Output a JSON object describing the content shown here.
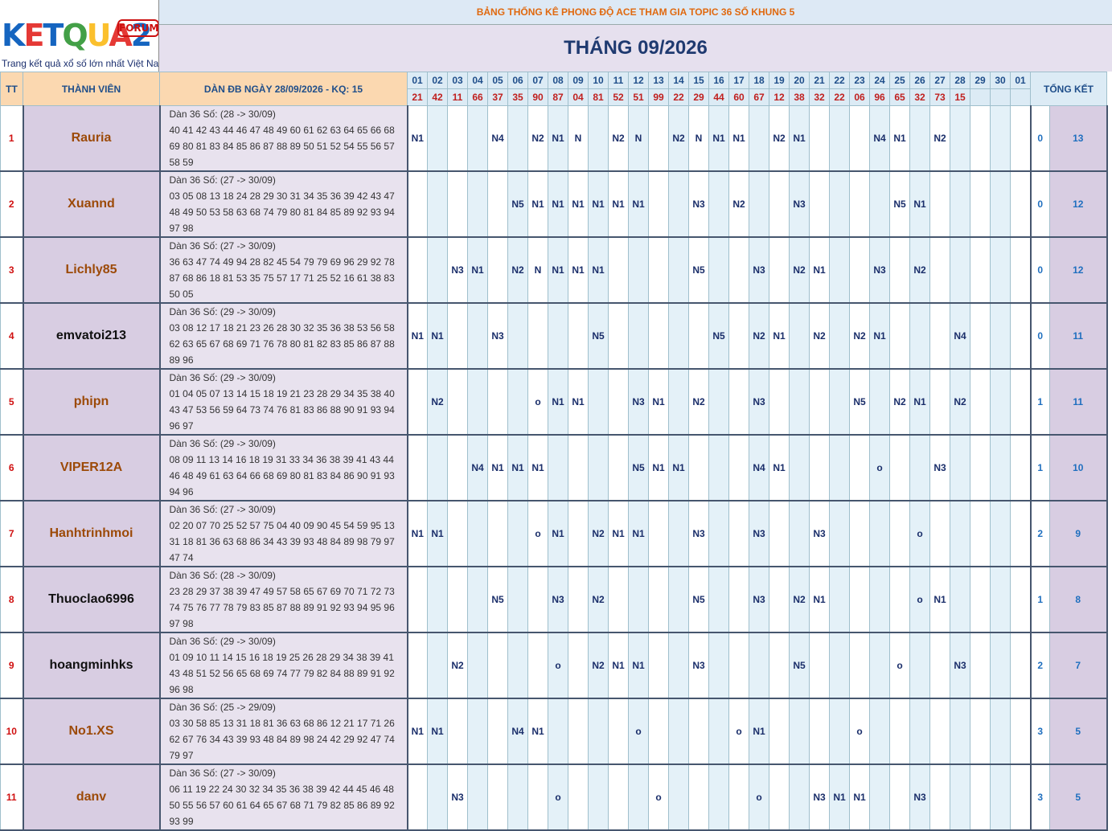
{
  "logo": {
    "letters": [
      {
        "ch": "K",
        "color": "#1565c0"
      },
      {
        "ch": "E",
        "color": "#e53935"
      },
      {
        "ch": "T",
        "color": "#1565c0"
      },
      {
        "ch": "Q",
        "color": "#43a047"
      },
      {
        "ch": "U",
        "color": "#fbc02d"
      },
      {
        "ch": "A",
        "color": "#e53935"
      },
      {
        "ch": "2",
        "color": "#1565c0"
      }
    ],
    "forum": "FORUM",
    "tagline": "Trang kết quả xổ số lớn nhất Việt Nam"
  },
  "banner": "BẢNG THỐNG KÊ PHONG ĐỘ ACE THAM GIA TOPIC 36 SỐ KHUNG 5",
  "month": "THÁNG 09/2026",
  "headers": {
    "tt": "TT",
    "member": "THÀNH VIÊN",
    "dan": "DÀN ĐB NGÀY 28/09/2026 - KQ: 15",
    "total": "TỔNG KẾT"
  },
  "days": [
    "01",
    "02",
    "03",
    "04",
    "05",
    "06",
    "07",
    "08",
    "09",
    "10",
    "11",
    "12",
    "13",
    "14",
    "15",
    "16",
    "17",
    "18",
    "19",
    "20",
    "21",
    "22",
    "23",
    "24",
    "25",
    "26",
    "27",
    "28",
    "29",
    "30",
    "01"
  ],
  "results": [
    "21",
    "42",
    "11",
    "66",
    "37",
    "35",
    "90",
    "87",
    "04",
    "81",
    "52",
    "51",
    "99",
    "22",
    "29",
    "44",
    "60",
    "67",
    "12",
    "38",
    "32",
    "22",
    "06",
    "96",
    "65",
    "32",
    "73",
    "15",
    "",
    "",
    ""
  ],
  "rows": [
    {
      "tt": "1",
      "name": "Rauria",
      "color": "brown",
      "title": "Dàn 36 Số: (28 -> 30/09)",
      "nums": "40 41 42 43 44 46 47 48 49 60 61 62 63 64 65 66 68 69 80 81 83 84 85 86 87 88 89 50 51 52 54 55 56 57 58 59",
      "cells": {
        "1": "N1",
        "5": "N4",
        "7": "N2",
        "8": "N1",
        "9": "N",
        "11": "N2",
        "12": "N",
        "14": "N2",
        "15": "N",
        "16": "N1",
        "17": "N1",
        "19": "N2",
        "20": "N1",
        "24": "N4",
        "25": "N1",
        "27": "N2"
      },
      "t1": "0",
      "t2": "13"
    },
    {
      "tt": "2",
      "name": "Xuannd",
      "color": "brown",
      "title": "Dàn 36 Số: (27 -> 30/09)",
      "nums": "03 05 08 13 18 24 28 29 30 31 34 35 36 39 42 43 47 48 49 50 53 58 63 68 74 79 80 81 84 85 89 92 93 94 97 98",
      "cells": {
        "6": "N5",
        "7": "N1",
        "8": "N1",
        "9": "N1",
        "10": "N1",
        "11": "N1",
        "12": "N1",
        "15": "N3",
        "17": "N2",
        "20": "N3",
        "25": "N5",
        "26": "N1"
      },
      "t1": "0",
      "t2": "12"
    },
    {
      "tt": "3",
      "name": "Lichly85",
      "color": "brown",
      "title": "Dàn 36 Số: (27 -> 30/09)",
      "nums": "36 63 47 74 49 94 28 82 45 54 79 79 69 96 29 92 78 87 68 86 18 81 53 35 75 57 17 71 25 52 16 61 38 83 50 05",
      "cells": {
        "3": "N3",
        "4": "N1",
        "6": "N2",
        "7": "N",
        "8": "N1",
        "9": "N1",
        "10": "N1",
        "15": "N5",
        "18": "N3",
        "20": "N2",
        "21": "N1",
        "24": "N3",
        "26": "N2"
      },
      "t1": "0",
      "t2": "12"
    },
    {
      "tt": "4",
      "name": "emvatoi213",
      "color": "black",
      "title": "Dàn 36 Số: (29 -> 30/09)",
      "nums": "03 08 12 17 18 21 23 26 28 30 32 35 36 38 53 56 58 62 63 65 67 68 69 71 76 78 80 81 82 83 85 86 87 88 89 96",
      "cells": {
        "1": "N1",
        "2": "N1",
        "5": "N3",
        "10": "N5",
        "16": "N5",
        "18": "N2",
        "19": "N1",
        "21": "N2",
        "23": "N2",
        "24": "N1",
        "28": "N4"
      },
      "t1": "0",
      "t2": "11"
    },
    {
      "tt": "5",
      "name": "phipn",
      "color": "brown",
      "title": "Dàn 36 Số: (29 -> 30/09)",
      "nums": "01 04 05 07 13 14 15 18 19 21 23 28 29 34 35 38 40 43 47 53 56 59 64 73 74 76 81 83 86 88 90 91 93 94 96 97",
      "cells": {
        "2": "N2",
        "7": "o",
        "8": "N1",
        "9": "N1",
        "12": "N3",
        "13": "N1",
        "15": "N2",
        "18": "N3",
        "23": "N5",
        "25": "N2",
        "26": "N1",
        "28": "N2"
      },
      "t1": "1",
      "t2": "11"
    },
    {
      "tt": "6",
      "name": "VIPER12A",
      "color": "brown",
      "title": "Dàn 36 Số: (29 -> 30/09)",
      "nums": "08 09 11 13 14 16 18 19 31 33 34 36 38 39 41 43 44 46 48 49 61 63 64 66 68 69 80 81 83 84 86 90 91 93 94 96",
      "cells": {
        "4": "N4",
        "5": "N1",
        "6": "N1",
        "7": "N1",
        "12": "N5",
        "13": "N1",
        "14": "N1",
        "18": "N4",
        "19": "N1",
        "24": "o",
        "27": "N3"
      },
      "t1": "1",
      "t2": "10"
    },
    {
      "tt": "7",
      "name": "Hanhtrinhmoi",
      "color": "brown",
      "title": "Dàn 36 Số: (27 -> 30/09)",
      "nums": "02 20 07 70 25 52 57 75 04 40 09 90 45 54 59 95 13 31 18 81 36 63 68 86 34 43 39 93 48 84 89 98 79 97 47 74",
      "cells": {
        "1": "N1",
        "2": "N1",
        "7": "o",
        "8": "N1",
        "10": "N2",
        "11": "N1",
        "12": "N1",
        "15": "N3",
        "18": "N3",
        "21": "N3",
        "26": "o"
      },
      "t1": "2",
      "t2": "9"
    },
    {
      "tt": "8",
      "name": "Thuoclao6996",
      "color": "black",
      "title": "Dàn 36 Số: (28 -> 30/09)",
      "nums": "23 28 29 37 38 39 47 49 57 58 65 67 69 70 71 72 73 74 75 76 77 78 79 83 85 87 88 89 91 92 93 94 95 96 97 98",
      "cells": {
        "5": "N5",
        "8": "N3",
        "10": "N2",
        "15": "N5",
        "18": "N3",
        "20": "N2",
        "21": "N1",
        "26": "o",
        "27": "N1"
      },
      "t1": "1",
      "t2": "8"
    },
    {
      "tt": "9",
      "name": "hoangminhks",
      "color": "black",
      "title": "Dàn 36 Số: (29 -> 30/09)",
      "nums": "01 09 10 11 14 15 16 18 19 25 26 28 29 34 38 39 41 43 48 51 52 56 65 68 69 74 77 79 82 84 88 89 91 92 96 98",
      "cells": {
        "3": "N2",
        "8": "o",
        "10": "N2",
        "11": "N1",
        "12": "N1",
        "15": "N3",
        "20": "N5",
        "25": "o",
        "28": "N3"
      },
      "t1": "2",
      "t2": "7"
    },
    {
      "tt": "10",
      "name": "No1.XS",
      "color": "brown",
      "title": "Dàn 36 Số: (25 -> 29/09)",
      "nums": "03 30 58 85 13 31 18 81 36 63 68 86 12 21 17 71 26 62 67 76 34 43 39 93 48 84 89 98 24 42 29 92 47 74 79 97",
      "cells": {
        "1": "N1",
        "2": "N1",
        "6": "N4",
        "7": "N1",
        "12": "o",
        "17": "o",
        "18": "N1",
        "23": "o"
      },
      "t1": "3",
      "t2": "5"
    },
    {
      "tt": "11",
      "name": "danv",
      "color": "brown",
      "title": "Dàn 36 Số: (27 -> 30/09)",
      "nums": "06 11 19 22 24 30 32 34 35 36 38 39 42 44 45 46 48 50 55 56 57 60 61 64 65 67 68 71 79 82 85 86 89 92 93 99",
      "cells": {
        "3": "N3",
        "8": "o",
        "13": "o",
        "18": "o",
        "21": "N3",
        "22": "N1",
        "23": "N1",
        "26": "N3"
      },
      "t1": "3",
      "t2": "5"
    }
  ]
}
